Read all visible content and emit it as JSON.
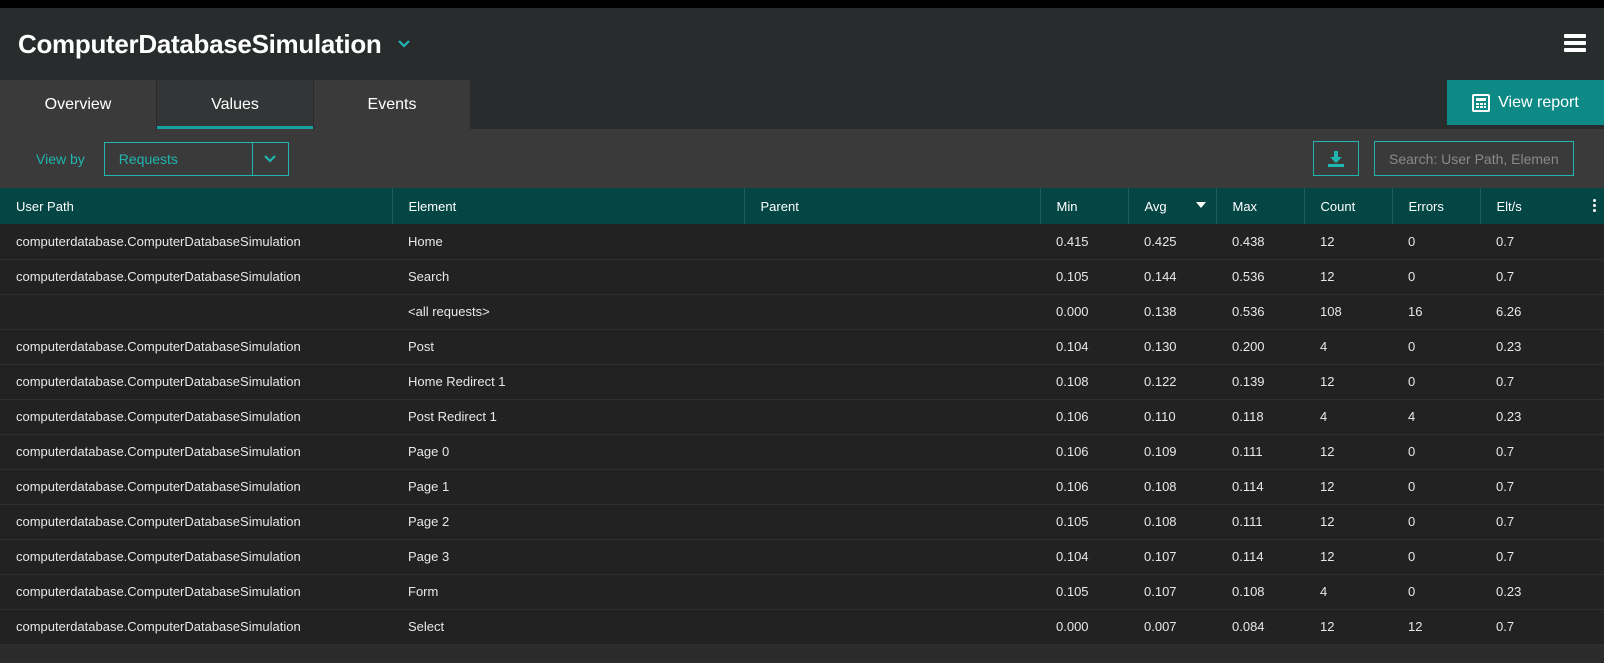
{
  "header": {
    "title": "ComputerDatabaseSimulation"
  },
  "tabs": [
    {
      "label": "Overview",
      "active": false
    },
    {
      "label": "Values",
      "active": true
    },
    {
      "label": "Events",
      "active": false
    }
  ],
  "view_report": {
    "label": "View report"
  },
  "toolbar": {
    "view_by_label": "View by",
    "view_by_value": "Requests",
    "search_placeholder": "Search: User Path, Element"
  },
  "colors": {
    "accent": "#1fb5b0",
    "header_row": "#034644",
    "view_report_bg": "#0d8a86"
  },
  "table": {
    "columns": [
      "User Path",
      "Element",
      "Parent",
      "Min",
      "Avg",
      "Max",
      "Count",
      "Errors",
      "Elt/s"
    ],
    "sorted_column": "Avg",
    "rows": [
      [
        "computerdatabase.ComputerDatabaseSimulation",
        "Home",
        "",
        "0.415",
        "0.425",
        "0.438",
        "12",
        "0",
        "0.7"
      ],
      [
        "computerdatabase.ComputerDatabaseSimulation",
        "Search",
        "",
        "0.105",
        "0.144",
        "0.536",
        "12",
        "0",
        "0.7"
      ],
      [
        "",
        "<all requests>",
        "",
        "0.000",
        "0.138",
        "0.536",
        "108",
        "16",
        "6.26"
      ],
      [
        "computerdatabase.ComputerDatabaseSimulation",
        "Post",
        "",
        "0.104",
        "0.130",
        "0.200",
        "4",
        "0",
        "0.23"
      ],
      [
        "computerdatabase.ComputerDatabaseSimulation",
        "Home Redirect 1",
        "",
        "0.108",
        "0.122",
        "0.139",
        "12",
        "0",
        "0.7"
      ],
      [
        "computerdatabase.ComputerDatabaseSimulation",
        "Post Redirect 1",
        "",
        "0.106",
        "0.110",
        "0.118",
        "4",
        "4",
        "0.23"
      ],
      [
        "computerdatabase.ComputerDatabaseSimulation",
        "Page 0",
        "",
        "0.106",
        "0.109",
        "0.111",
        "12",
        "0",
        "0.7"
      ],
      [
        "computerdatabase.ComputerDatabaseSimulation",
        "Page 1",
        "",
        "0.106",
        "0.108",
        "0.114",
        "12",
        "0",
        "0.7"
      ],
      [
        "computerdatabase.ComputerDatabaseSimulation",
        "Page 2",
        "",
        "0.105",
        "0.108",
        "0.111",
        "12",
        "0",
        "0.7"
      ],
      [
        "computerdatabase.ComputerDatabaseSimulation",
        "Page 3",
        "",
        "0.104",
        "0.107",
        "0.114",
        "12",
        "0",
        "0.7"
      ],
      [
        "computerdatabase.ComputerDatabaseSimulation",
        "Form",
        "",
        "0.105",
        "0.107",
        "0.108",
        "4",
        "0",
        "0.23"
      ],
      [
        "computerdatabase.ComputerDatabaseSimulation",
        "Select",
        "",
        "0.000",
        "0.007",
        "0.084",
        "12",
        "12",
        "0.7"
      ]
    ]
  }
}
